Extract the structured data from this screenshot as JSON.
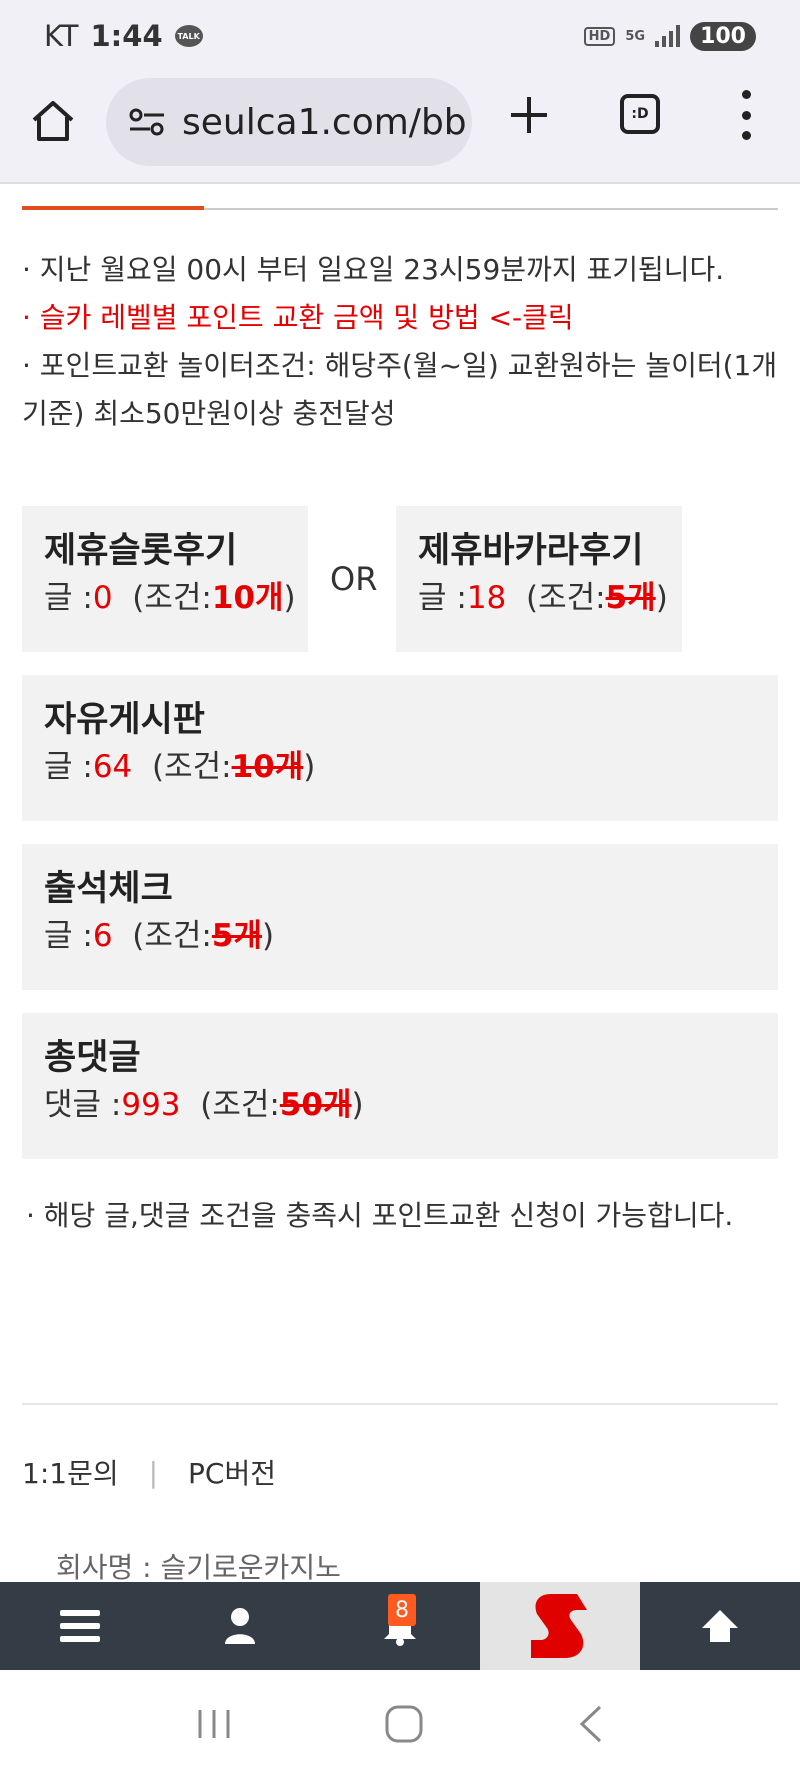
{
  "status_bar": {
    "carrier": "KT",
    "time": "1:44",
    "talk_label": "TALK",
    "hd_label": "HD",
    "network_label": "5G",
    "battery": "100"
  },
  "browser": {
    "url": "seulca1.com/bb",
    "tabs_label": ":D"
  },
  "notes": {
    "line1": "· 지난 월요일 00시 부터 일요일 23시59분까지 표기됩니다.",
    "line2": "· 슬카 레벨별 포인트 교환 금액 및 방법 <-클릭",
    "line3": "· 포인트교환 놀이터조건: 해당주(월~일) 교환원하는 놀이터(1개기준) 최소50만원이상 충전달성"
  },
  "or_label": "OR",
  "cards": [
    {
      "title": "제휴슬롯후기",
      "prefix": "글 :",
      "count": "0",
      "cond_prefix": "(조건:",
      "requirement": "10개",
      "cond_suffix": ")"
    },
    {
      "title": "제휴바카라후기",
      "prefix": "글 :",
      "count": "18",
      "cond_prefix": "(조건:",
      "requirement": "5개",
      "cond_suffix": ")"
    },
    {
      "title": "자유게시판",
      "prefix": "글 :",
      "count": "64",
      "cond_prefix": "(조건:",
      "requirement": "10개",
      "cond_suffix": ")"
    },
    {
      "title": "출석체크",
      "prefix": "글 :",
      "count": "6",
      "cond_prefix": "(조건:",
      "requirement": "5개",
      "cond_suffix": ")"
    },
    {
      "title": "총댓글",
      "prefix": "댓글 :",
      "count": "993",
      "cond_prefix": "(조건:",
      "requirement": "50개",
      "cond_suffix": ")"
    }
  ],
  "bottom_note": "· 해당 글,댓글 조건을 충족시 포인트교환 신청이 가능합니다.",
  "footer": {
    "inquiry": "1:1문의",
    "separator": "|",
    "pc_version": "PC버전",
    "company": "회사명 : 슬기로운카지노"
  },
  "bottom_nav": {
    "notification_count": "8"
  },
  "colors": {
    "accent": "#e44a1c",
    "highlight_red": "#e60000",
    "nav_bg": "#343c46"
  }
}
